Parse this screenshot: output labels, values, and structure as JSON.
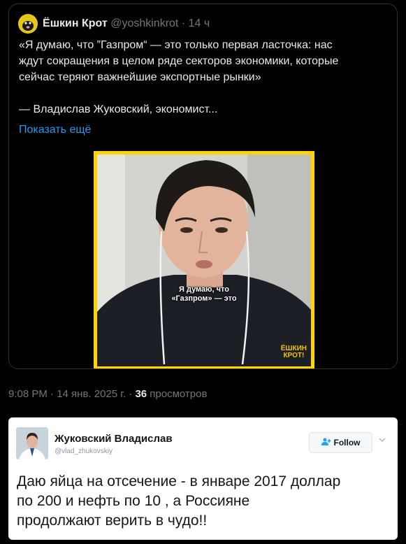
{
  "tweet": {
    "author_name": "Ёшкин Крот",
    "author_handle": "@yoshkinkrot",
    "time_ago": "· 14 ч",
    "text": "«Я думаю, что ”Газпром“ — это только первая ласточка: нас\nждут сокращения в целом ряде секторов экономики, которые\nсейчас теряют важнейшие экспортные рынки»\n\n— Владислав Жуковский, экономист...",
    "show_more": "Показать ещё",
    "video": {
      "caption": "Я думаю, что\n«Газпром» — это",
      "logo": "ЁШКИН\nКРОТ!"
    },
    "timestamp": "9:08 PM · 14 янв. 2025 г. ·",
    "views_count": "36",
    "views_label": "просмотров"
  },
  "quoted_tweet": {
    "author_name": "Жуковский Владислав",
    "author_handle": "@vlad_zhukovskiy",
    "follow_label": "Follow",
    "text": "Даю яйца на отсечение - в январе 2017 доллар\nпо 200 и нефть по 10 , а Россияне\nпродолжают верить в чудо!!"
  },
  "colors": {
    "accent_link": "#1d9bf0",
    "video_border": "#ffd400"
  },
  "icons": [
    "avatar-mole-icon",
    "follow-person-plus-icon",
    "chevron-down-icon"
  ]
}
